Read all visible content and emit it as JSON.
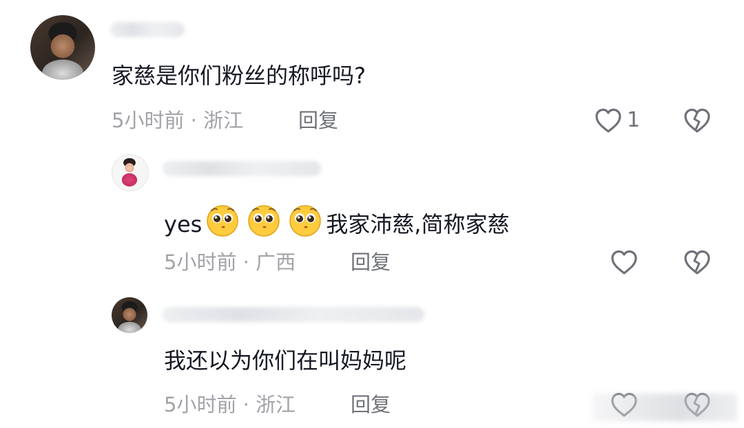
{
  "comments": [
    {
      "avatar_icon": "avatar-man-photo",
      "text": "家慈是你们粉丝的称呼吗?",
      "time": "5小时前",
      "separator": "·",
      "location": "浙江",
      "reply_label": "回复",
      "like_count": "1"
    },
    {
      "avatar_icon": "avatar-girl-cartoon",
      "text_prefix": "yes",
      "emoji_name": "pleading-face-emoji",
      "text_suffix": "我家沛慈,简称家慈",
      "time": "5小时前",
      "separator": "·",
      "location": "广西",
      "reply_label": "回复",
      "like_count": ""
    },
    {
      "avatar_icon": "avatar-man-photo",
      "text": "我还以为你们在叫妈妈呢",
      "time": "5小时前",
      "separator": "·",
      "location": "浙江",
      "reply_label": "回复",
      "like_count": ""
    }
  ],
  "icons": {
    "like": "heart-outline-icon",
    "dislike": "broken-heart-icon"
  },
  "colors": {
    "text": "#161823",
    "meta": "#a1a3a8",
    "action": "#6f7178"
  }
}
